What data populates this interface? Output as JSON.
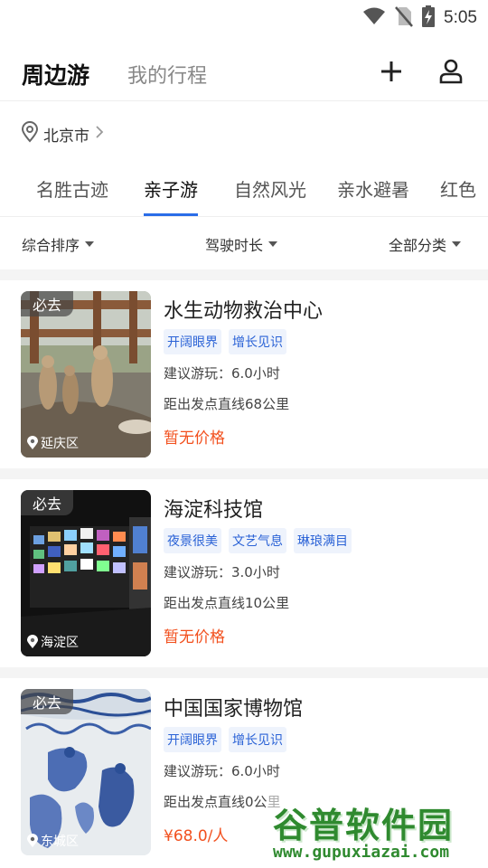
{
  "status_bar": {
    "time": "5:05",
    "icons": [
      "wifi-icon",
      "no-sim-icon",
      "battery-charging-icon"
    ]
  },
  "header": {
    "title": "周边游",
    "secondary_tab": "我的行程",
    "actions": [
      "plus-icon",
      "user-icon"
    ]
  },
  "location": {
    "city": "北京市"
  },
  "category_tabs": [
    {
      "label": "名胜古迹",
      "active": false
    },
    {
      "label": "亲子游",
      "active": true
    },
    {
      "label": "自然风光",
      "active": false
    },
    {
      "label": "亲水避暑",
      "active": false
    },
    {
      "label": "红色",
      "active": false
    }
  ],
  "filters": {
    "sort": "综合排序",
    "duration": "驾驶时长",
    "category": "全部分类"
  },
  "attractions": [
    {
      "badge": "必去",
      "district": "延庆区",
      "name": "水生动物救治中心",
      "tags": [
        "开阔眼界",
        "增长见识"
      ],
      "suggested": "建议游玩：6.0小时",
      "distance": "距出发点直线68公里",
      "price": "暂无价格"
    },
    {
      "badge": "必去",
      "district": "海淀区",
      "name": "海淀科技馆",
      "tags": [
        "夜景很美",
        "文艺气息",
        "琳琅满目"
      ],
      "suggested": "建议游玩：3.0小时",
      "distance": "距出发点直线10公里",
      "price": "暂无价格"
    },
    {
      "badge": "必去",
      "district": "东城区",
      "name": "中国国家博物馆",
      "tags": [
        "开阔眼界",
        "增长见识"
      ],
      "suggested": "建议游玩：6.0小时",
      "distance": "距出发点直线0公里",
      "price": "¥68.0/人"
    }
  ],
  "watermark": {
    "name": "谷普软件园",
    "url": "www.gupuxiazai.com"
  },
  "colors": {
    "accent": "#2a6de8",
    "price": "#f2501e",
    "tag_bg": "#eef3fc",
    "tag_text": "#2a62d6"
  }
}
